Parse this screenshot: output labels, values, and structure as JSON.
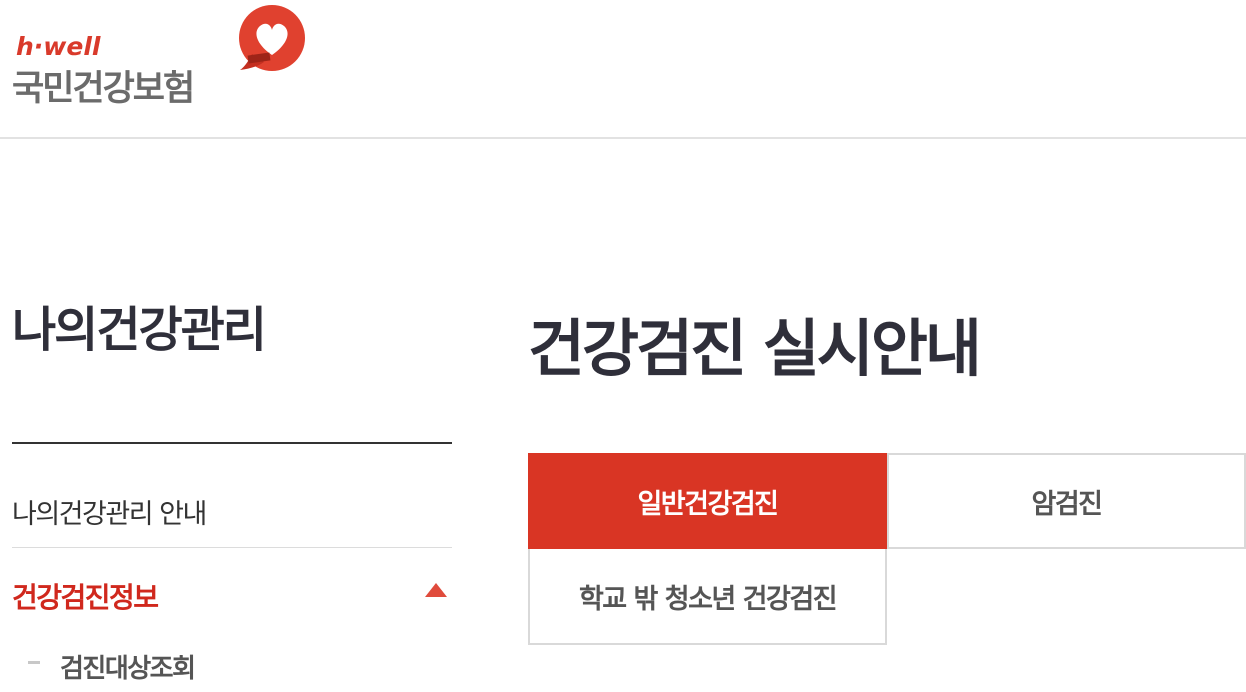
{
  "header": {
    "logo_tagline": "h·well",
    "logo_name": "국민건강보험"
  },
  "sidebar": {
    "title": "나의건강관리",
    "items": [
      {
        "label": "나의건강관리 안내"
      },
      {
        "label": "건강검진정보",
        "expanded": true,
        "color": "#d0281d"
      }
    ],
    "sub_items": [
      {
        "label": "검진대상조회"
      }
    ]
  },
  "main": {
    "title": "건강검진 실시안내",
    "tabs": [
      {
        "label": "일반건강검진",
        "active": true,
        "color": "#d93524"
      },
      {
        "label": "암검진",
        "active": false
      },
      {
        "label": "학교 밖 청소년 건강검진",
        "active": false
      }
    ]
  },
  "icons": {
    "logo_mark": "heart-speech-bubble-icon",
    "expand_indicator": "triangle-up-icon"
  },
  "colors": {
    "accent": "#d93524",
    "text_dark": "#2f2f3a",
    "logo_gray": "#6b6b6b"
  }
}
